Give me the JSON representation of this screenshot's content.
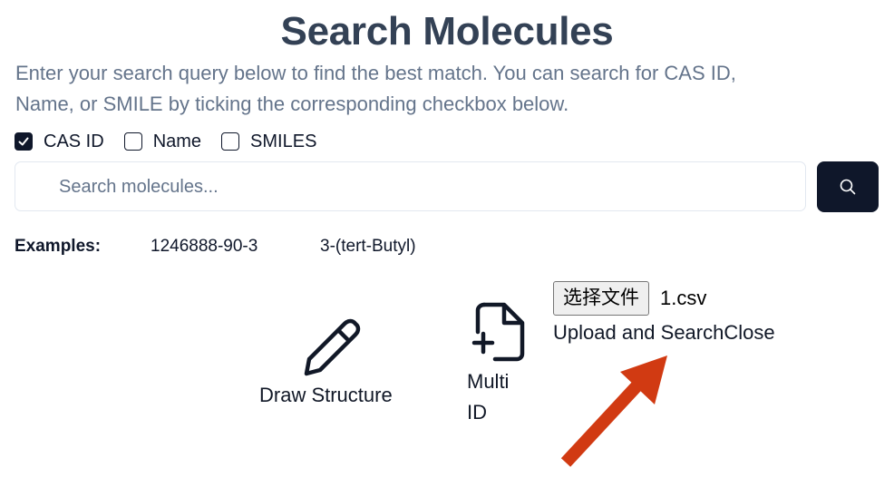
{
  "header": {
    "title": "Search Molecules",
    "description": "Enter your search query below to find the best match. You can search for CAS ID, Name, or SMILE by ticking the corresponding checkbox below."
  },
  "filters": [
    {
      "label": "CAS ID",
      "checked": true
    },
    {
      "label": "Name",
      "checked": false
    },
    {
      "label": "SMILES",
      "checked": false
    }
  ],
  "search": {
    "placeholder": "Search molecules...",
    "value": "",
    "button_icon": "search-icon"
  },
  "examples": {
    "label": "Examples:",
    "items": [
      "1246888-90-3",
      "3-(tert-Butyl)"
    ]
  },
  "tools": {
    "draw": {
      "label": "Draw Structure",
      "icon": "pencil-icon"
    },
    "multi": {
      "label_line1": "Multi",
      "label_line2": "ID",
      "icon": "file-plus-icon"
    }
  },
  "upload": {
    "choose_file_label": "选择文件",
    "file_name": "1.csv",
    "upload_label": "Upload and Search",
    "close_label": "Close"
  },
  "colors": {
    "primary": "#0f172a",
    "title": "#334155",
    "muted": "#64748b",
    "annotation_arrow": "#d13a12"
  }
}
